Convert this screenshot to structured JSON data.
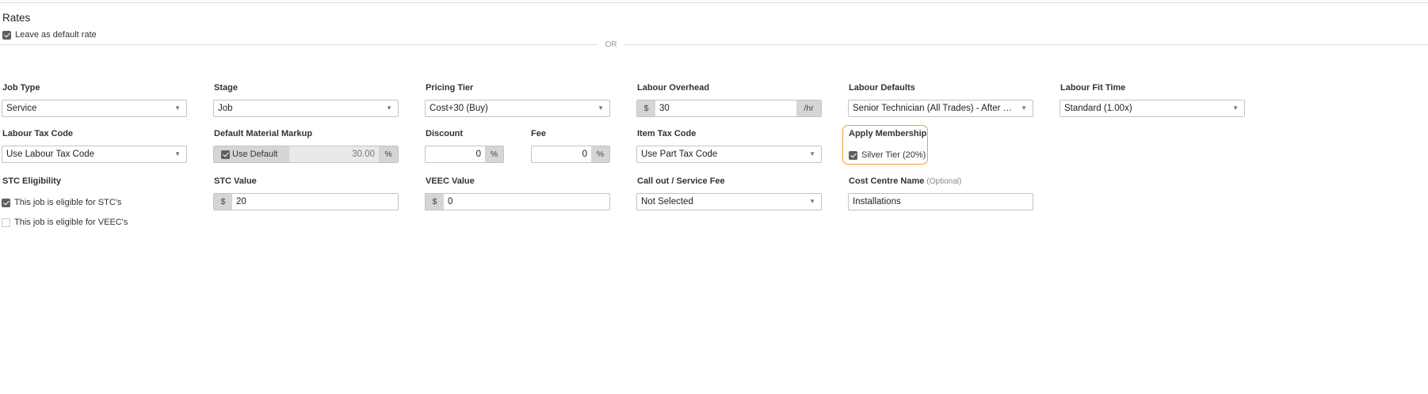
{
  "header": {
    "title": "Rates"
  },
  "default_rate": {
    "label": "Leave as default rate",
    "checked": true
  },
  "separator": {
    "text": "OR"
  },
  "job_type": {
    "label": "Job Type",
    "value": "Service"
  },
  "stage": {
    "label": "Stage",
    "value": "Job"
  },
  "pricing_tier": {
    "label": "Pricing Tier",
    "value": "Cost+30 (Buy)"
  },
  "labour_overhead": {
    "label": "Labour Overhead",
    "prefix": "$",
    "value": "30",
    "suffix": "/hr"
  },
  "labour_defaults": {
    "label": "Labour Defaults",
    "value": "Senior Technician (All Trades) - After Hours"
  },
  "labour_fit_time": {
    "label": "Labour Fit Time",
    "value": "Standard (1.00x)"
  },
  "labour_tax_code": {
    "label": "Labour Tax Code",
    "value": "Use Labour Tax Code"
  },
  "default_material_markup": {
    "label": "Default Material Markup",
    "checkbox_label": "Use Default",
    "checked": true,
    "value": "30.00",
    "suffix": "%"
  },
  "discount": {
    "label": "Discount",
    "value": "0",
    "suffix": "%"
  },
  "fee": {
    "label": "Fee",
    "value": "0",
    "suffix": "%"
  },
  "item_tax_code": {
    "label": "Item Tax Code",
    "value": "Use Part Tax Code"
  },
  "apply_membership": {
    "label": "Apply Membership",
    "option_label": "Silver Tier (20%)",
    "checked": true,
    "highlight_color": "#f0a030"
  },
  "stc_eligibility": {
    "label": "STC Eligibility",
    "stc_label": "This job is eligible for STC's",
    "stc_checked": true,
    "veec_label": "This job is eligible for VEEC's",
    "veec_checked": false
  },
  "stc_value": {
    "label": "STC Value",
    "prefix": "$",
    "value": "20"
  },
  "veec_value": {
    "label": "VEEC Value",
    "prefix": "$",
    "value": "0"
  },
  "call_out_fee": {
    "label": "Call out / Service Fee",
    "value": "Not Selected"
  },
  "cost_centre": {
    "label": "Cost Centre Name",
    "optional": "(Optional)",
    "value": "Installations"
  }
}
